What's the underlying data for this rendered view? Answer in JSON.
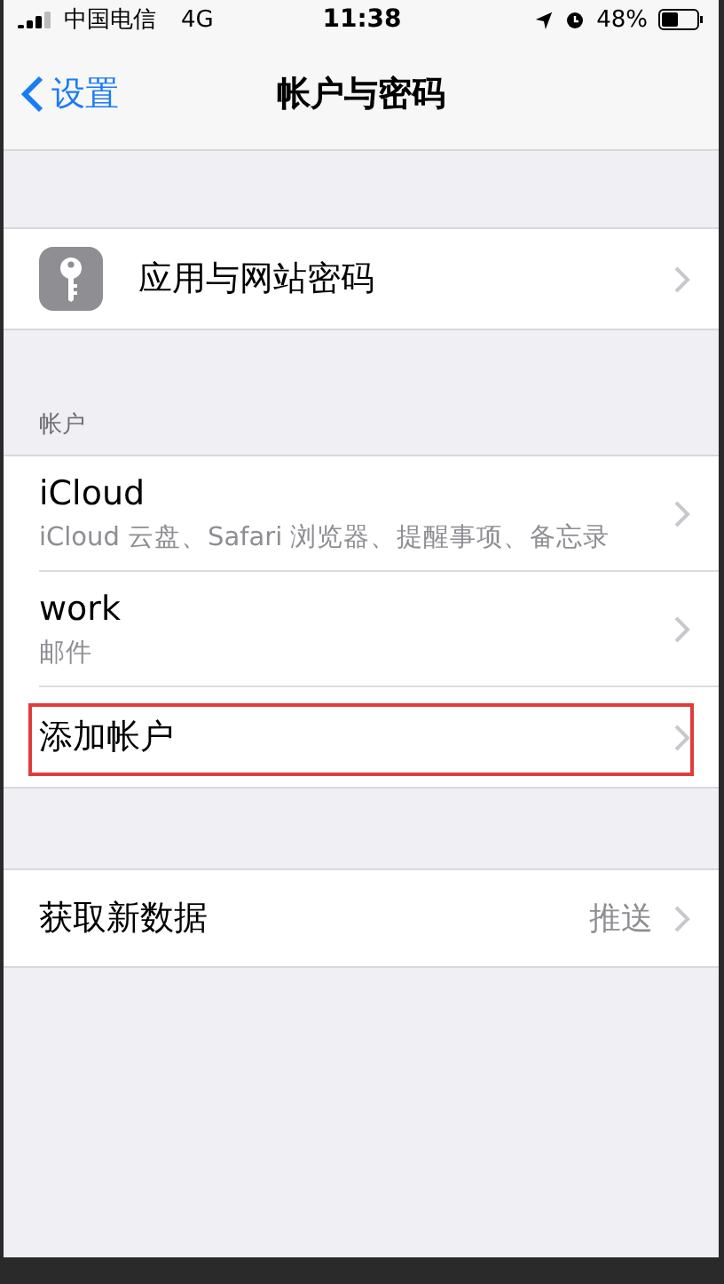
{
  "status_bar": {
    "carrier": "中国电信",
    "network": "4G",
    "time": "11:38",
    "battery": "48%"
  },
  "nav": {
    "back": "设置",
    "title": "帐户与密码"
  },
  "passwords": {
    "label": "应用与网站密码"
  },
  "accounts": {
    "header": "帐户",
    "items": [
      {
        "title": "iCloud",
        "subtitle": "iCloud 云盘、Safari 浏览器、提醒事项、备忘录",
        "highlighted": false
      },
      {
        "title": "work",
        "subtitle": "邮件",
        "highlighted": false
      },
      {
        "title": "添加帐户",
        "highlighted": true
      }
    ]
  },
  "fetch": {
    "label": "获取新数据",
    "value": "推送"
  }
}
